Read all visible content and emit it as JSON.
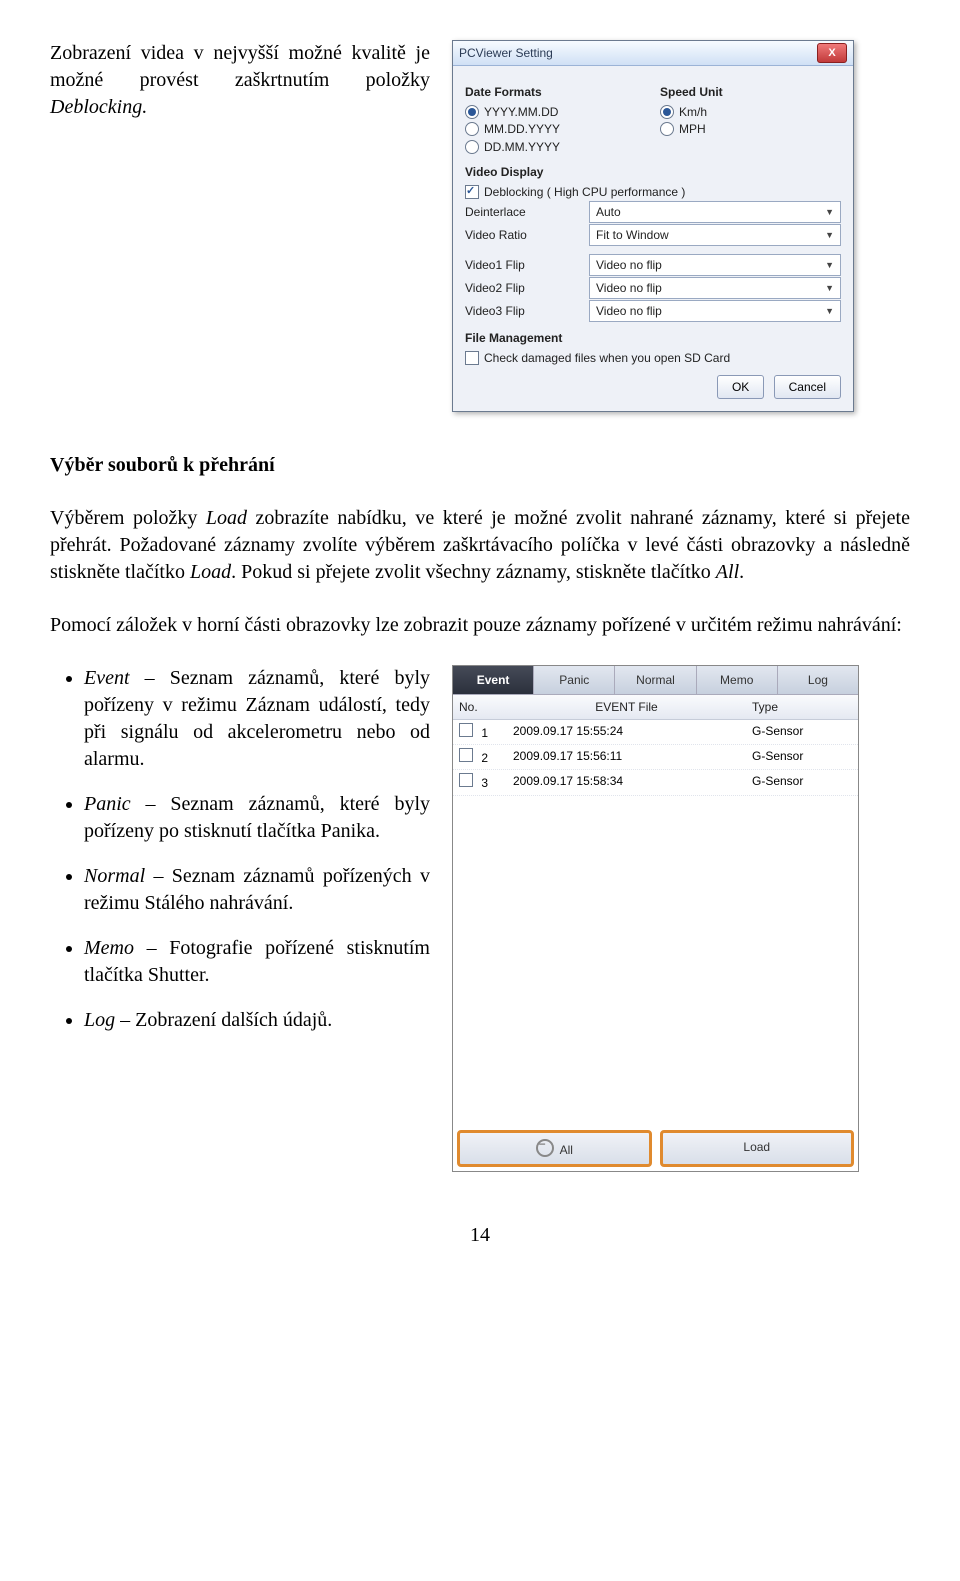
{
  "doc": {
    "intro": "Zobrazení videa v nejvyšší možné kvalitě je možné provést zaškrtnutím položky ",
    "intro_em": "Deblocking.",
    "h1": "Výběr souborů k přehrání",
    "p1a": "Výběrem položky ",
    "p1em1": "Load",
    "p1b": " zobrazíte nabídku, ve které je možné zvolit nahrané záznamy, které si přejete přehrát. Požadované záznamy zvolíte výběrem zaškrtávacího políčka v levé části obrazovky a následně stiskněte tlačítko ",
    "p1em2": "Load",
    "p1c": ". Pokud si přejete zvolit všechny záznamy, stiskněte tlačítko ",
    "p1em3": "All",
    "p1d": ".",
    "p2": "Pomocí záložek v horní části obrazovky lze zobrazit pouze záznamy pořízené v určitém režimu nahrávání:",
    "li1em": "Event",
    "li1": " – Seznam záznamů, které byly pořízeny v režimu Záznam událostí, tedy při signálu od akcelerometru nebo od alarmu.",
    "li2em": "Panic",
    "li2": " – Seznam záznamů, které byly pořízeny po stisknutí tlačítka Panika.",
    "li3em": "Normal",
    "li3": " – Seznam záznamů pořízených v režimu Stálého nahrávání.",
    "li4em": "Memo",
    "li4": " – Fotografie pořízené stisknutím tlačítka Shutter.",
    "li5em": "Log",
    "li5": " – Zobrazení dalších údajů.",
    "pagen": "14"
  },
  "dlg": {
    "title": "PCViewer Setting",
    "grp_date": "Date Formats",
    "date1": "YYYY.MM.DD",
    "date2": "MM.DD.YYYY",
    "date3": "DD.MM.YYYY",
    "grp_speed": "Speed Unit",
    "sp1": "Km/h",
    "sp2": "MPH",
    "grp_vid": "Video Display",
    "deblock": "Deblocking ( High CPU performance )",
    "deint_l": "Deinterlace",
    "deint_v": "Auto",
    "ratio_l": "Video Ratio",
    "ratio_v": "Fit to Window",
    "v1_l": "Video1 Flip",
    "v1_v": "Video no flip",
    "v2_l": "Video2 Flip",
    "v2_v": "Video no flip",
    "v3_l": "Video3 Flip",
    "v3_v": "Video no flip",
    "grp_file": "File Management",
    "fchk": "Check damaged files when you open SD Card",
    "ok": "OK",
    "cancel": "Cancel"
  },
  "list": {
    "tabs": [
      "Event",
      "Panic",
      "Normal",
      "Memo",
      "Log"
    ],
    "col_no": "No.",
    "col_file": "EVENT File",
    "col_type": "Type",
    "rows": [
      {
        "n": "1",
        "f": "2009.09.17 15:55:24",
        "t": "G-Sensor"
      },
      {
        "n": "2",
        "f": "2009.09.17 15:56:11",
        "t": "G-Sensor"
      },
      {
        "n": "3",
        "f": "2009.09.17 15:58:34",
        "t": "G-Sensor"
      }
    ],
    "all": "All",
    "load": "Load"
  }
}
